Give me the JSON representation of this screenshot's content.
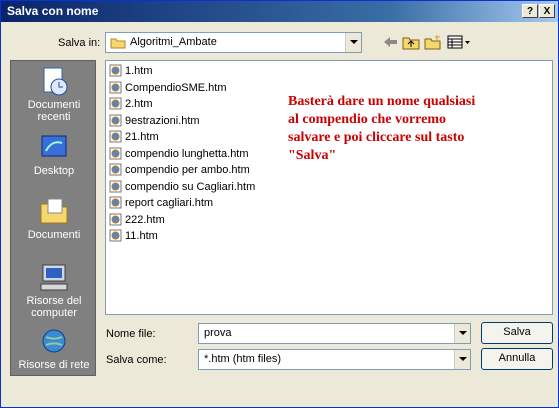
{
  "window": {
    "title": "Salva con nome",
    "help_label": "?",
    "close_label": "X"
  },
  "toolbar": {
    "save_in_label": "Salva in:",
    "folder": "Algoritmi_Ambate"
  },
  "places": [
    {
      "label": "Documenti recenti",
      "icon": "recent-documents-icon"
    },
    {
      "label": "Desktop",
      "icon": "desktop-icon"
    },
    {
      "label": "Documenti",
      "icon": "documents-folder-icon"
    },
    {
      "label": "Risorse del computer",
      "icon": "computer-icon"
    },
    {
      "label": "Risorse di rete",
      "icon": "network-icon"
    }
  ],
  "files": [
    "1.htm",
    "CompendioSME.htm",
    "2.htm",
    "9estrazioni.htm",
    "21.htm",
    "compendio lunghetta.htm",
    "compendio per ambo.htm",
    "compendio su Cagliari.htm",
    "report cagliari.htm",
    "222.htm",
    "11.htm"
  ],
  "annotation": "Basterà dare un nome qualsiasi al compendio che vorremo salvare e poi cliccare sul tasto \"Salva\"",
  "form": {
    "filename_label": "Nome file:",
    "filename_value": "prova",
    "filetype_label": "Salva come:",
    "filetype_value": "*.htm (htm files)",
    "save_button": "Salva",
    "cancel_button": "Annulla"
  }
}
